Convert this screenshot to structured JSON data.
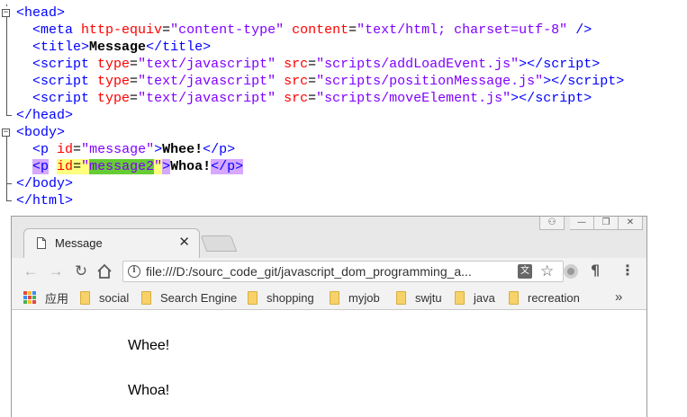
{
  "editor": {
    "lines": [
      {
        "segments": [
          {
            "t": "<",
            "c": "tg"
          },
          {
            "t": "head",
            "c": "tg"
          },
          {
            "t": ">",
            "c": "tg"
          }
        ]
      },
      {
        "segments": [
          {
            "t": "  <",
            "c": "tg"
          },
          {
            "t": "meta",
            "c": "tg"
          },
          {
            "t": " http-equiv",
            "c": "at"
          },
          {
            "t": "=",
            "c": "eq"
          },
          {
            "t": "\"content-type\"",
            "c": "st"
          },
          {
            "t": " content",
            "c": "at"
          },
          {
            "t": "=",
            "c": "eq"
          },
          {
            "t": "\"text/html; charset=utf-8\"",
            "c": "st"
          },
          {
            "t": " />",
            "c": "tg"
          }
        ]
      },
      {
        "segments": [
          {
            "t": "  <",
            "c": "tg"
          },
          {
            "t": "title",
            "c": "tg"
          },
          {
            "t": ">",
            "c": "tg"
          },
          {
            "t": "Message",
            "c": "tx"
          },
          {
            "t": "</",
            "c": "tg"
          },
          {
            "t": "title",
            "c": "tg"
          },
          {
            "t": ">",
            "c": "tg"
          }
        ]
      },
      {
        "segments": [
          {
            "t": "  <",
            "c": "tg"
          },
          {
            "t": "script",
            "c": "tg"
          },
          {
            "t": " type",
            "c": "at"
          },
          {
            "t": "=",
            "c": "eq"
          },
          {
            "t": "\"text/javascript\"",
            "c": "st"
          },
          {
            "t": " src",
            "c": "at"
          },
          {
            "t": "=",
            "c": "eq"
          },
          {
            "t": "\"scripts/addLoadEvent.js\"",
            "c": "st"
          },
          {
            "t": "></",
            "c": "tg"
          },
          {
            "t": "script",
            "c": "tg"
          },
          {
            "t": ">",
            "c": "tg"
          }
        ]
      },
      {
        "segments": [
          {
            "t": "  <",
            "c": "tg"
          },
          {
            "t": "script",
            "c": "tg"
          },
          {
            "t": " type",
            "c": "at"
          },
          {
            "t": "=",
            "c": "eq"
          },
          {
            "t": "\"text/javascript\"",
            "c": "st"
          },
          {
            "t": " src",
            "c": "at"
          },
          {
            "t": "=",
            "c": "eq"
          },
          {
            "t": "\"scripts/positionMessage.js\"",
            "c": "st"
          },
          {
            "t": "></",
            "c": "tg"
          },
          {
            "t": "script",
            "c": "tg"
          },
          {
            "t": ">",
            "c": "tg"
          }
        ]
      },
      {
        "segments": [
          {
            "t": "  <",
            "c": "tg"
          },
          {
            "t": "script",
            "c": "tg"
          },
          {
            "t": " type",
            "c": "at"
          },
          {
            "t": "=",
            "c": "eq"
          },
          {
            "t": "\"text/javascript\"",
            "c": "st"
          },
          {
            "t": " src",
            "c": "at"
          },
          {
            "t": "=",
            "c": "eq"
          },
          {
            "t": "\"scripts/moveElement.js\"",
            "c": "st"
          },
          {
            "t": "></",
            "c": "tg"
          },
          {
            "t": "script",
            "c": "tg"
          },
          {
            "t": ">",
            "c": "tg"
          }
        ]
      },
      {
        "segments": [
          {
            "t": "</",
            "c": "tg"
          },
          {
            "t": "head",
            "c": "tg"
          },
          {
            "t": ">",
            "c": "tg"
          }
        ]
      },
      {
        "segments": [
          {
            "t": "<",
            "c": "tg"
          },
          {
            "t": "body",
            "c": "tg"
          },
          {
            "t": ">",
            "c": "tg"
          }
        ]
      },
      {
        "segments": [
          {
            "t": "  <",
            "c": "tg"
          },
          {
            "t": "p",
            "c": "tg"
          },
          {
            "t": " id",
            "c": "at"
          },
          {
            "t": "=",
            "c": "eq"
          },
          {
            "t": "\"message\"",
            "c": "st"
          },
          {
            "t": ">",
            "c": "tg"
          },
          {
            "t": "Whee!",
            "c": "tx"
          },
          {
            "t": "</",
            "c": "tg"
          },
          {
            "t": "p",
            "c": "tg"
          },
          {
            "t": ">",
            "c": "tg"
          }
        ]
      },
      {
        "segments": [
          {
            "t": "  ",
            "c": "eq"
          },
          {
            "t": "<p",
            "c": "tg hl-tag"
          },
          {
            "t": " ",
            "c": "eq"
          },
          {
            "t": "id",
            "c": "at hl-attr"
          },
          {
            "t": "=",
            "c": "eq hl-attr"
          },
          {
            "t": "\"",
            "c": "st hl-attr"
          },
          {
            "t": "message2",
            "c": "st hl-val"
          },
          {
            "t": "\"",
            "c": "st hl-attr"
          },
          {
            "t": ">",
            "c": "tg hl-tag"
          },
          {
            "t": "Whoa!",
            "c": "tx"
          },
          {
            "t": "</p>",
            "c": "tg hl-tag"
          }
        ]
      },
      {
        "segments": [
          {
            "t": "</",
            "c": "tg"
          },
          {
            "t": "body",
            "c": "tg"
          },
          {
            "t": ">",
            "c": "tg"
          }
        ]
      },
      {
        "segments": [
          {
            "t": "</",
            "c": "tg"
          },
          {
            "t": "html",
            "c": "tg"
          },
          {
            "t": ">",
            "c": "tg"
          }
        ]
      }
    ]
  },
  "browser": {
    "tab_title": "Message",
    "tab_close": "✕",
    "url": "file:///D:/sourc_code_git/javascript_dom_programming_a...",
    "window_buttons": [
      "⚇",
      "—",
      "❐",
      "✕"
    ],
    "apps_label": "应用",
    "bookmarks": [
      "social",
      "Search Engine",
      "shopping",
      "myjob",
      "swjtu",
      "java",
      "recreation"
    ],
    "more_bookmarks": "»",
    "content_paragraphs": [
      "Whee!",
      "Whoa!"
    ]
  }
}
